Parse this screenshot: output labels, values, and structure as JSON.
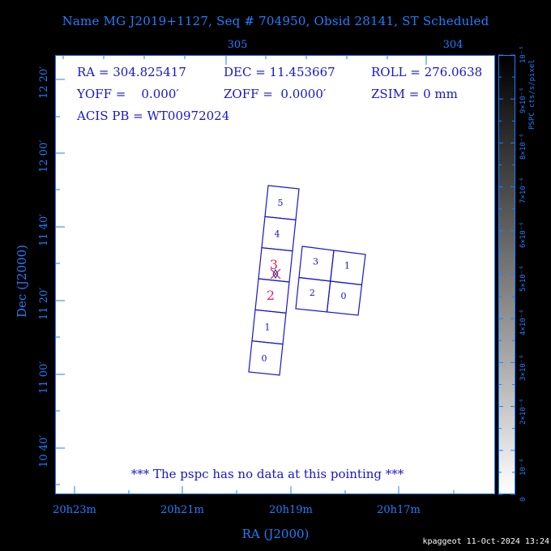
{
  "title": "Name MG J2019+1127, Seq # 704950, Obsid 28141, ST Scheduled",
  "top_axis": {
    "labels": [
      "305",
      "304"
    ]
  },
  "info": {
    "ra": "RA = 304.825417",
    "dec": "DEC = 11.453667",
    "roll": "ROLL = 276.0638",
    "yoff": "YOFF =    0.000′",
    "zoff": "ZOFF =  0.0000′",
    "zsim": "ZSIM = 0 mm",
    "acis_pb": "ACIS PB = WT00972024"
  },
  "note": "*** The pspc has no data at this pointing ***",
  "y_axis": {
    "title": "Dec (J2000)",
    "labels": [
      "12 20′",
      "12 00′",
      "11 40′",
      "11 20′",
      "11 00′",
      "10 40′"
    ]
  },
  "x_axis": {
    "title": "RA (J2000)",
    "labels": [
      "20h23m",
      "20h21m",
      "20h19m",
      "20h17m"
    ]
  },
  "colorbar": {
    "unit": "PSPC cts/s/pixel",
    "labels": [
      "0",
      "10⁻⁶",
      "2×10⁻⁶",
      "3×10⁻⁶",
      "4×10⁻⁶",
      "5×10⁻⁶",
      "6×10⁻⁶",
      "7×10⁻⁶",
      "8×10⁻⁶",
      "9×10⁻⁶",
      "10⁻⁵"
    ],
    "range": [
      0,
      1e-05
    ]
  },
  "chips": {
    "s_array": [
      "0",
      "1",
      "2",
      "3",
      "4",
      "5"
    ],
    "i_array": [
      "3",
      "1",
      "2",
      "0"
    ],
    "highlighted": [
      "2",
      "3"
    ],
    "highlight_color": "#e0206a",
    "chip_color": "#1515d0"
  },
  "footer": "kpaggeot 11-Oct-2024 13:24"
}
